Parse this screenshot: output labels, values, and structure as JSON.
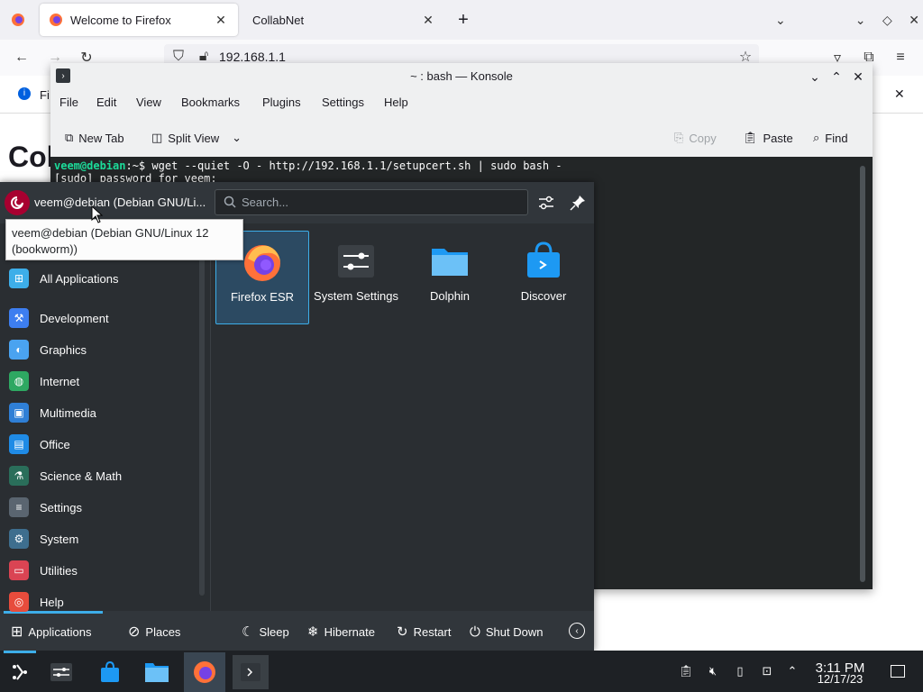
{
  "firefox": {
    "tabs": [
      {
        "title": "Welcome to Firefox",
        "active": true
      },
      {
        "title": "CollabNet",
        "active": false
      }
    ],
    "url": "192.168.1.1",
    "page_heading": "Col",
    "notification_visible_text": "Fi"
  },
  "konsole": {
    "title": "~ : bash — Konsole",
    "menu": [
      "File",
      "Edit",
      "View",
      "Bookmarks",
      "Plugins",
      "Settings",
      "Help"
    ],
    "toolbar": {
      "new_tab": "New Tab",
      "split_view": "Split View",
      "copy": "Copy",
      "paste": "Paste",
      "find": "Find"
    },
    "terminal": {
      "prompt": "veem@debian",
      "path_sep": ":~$",
      "command": " wget --quiet -O - http://192.168.1.1/setupcert.sh | sudo bash -",
      "line2": "[sudo] password for veem:"
    }
  },
  "kickoff": {
    "user": "veem@debian (Debian GNU/Li...",
    "search_placeholder": "Search...",
    "tooltip": "veem@debian (Debian GNU/Linux 12 (bookworm))",
    "categories": [
      {
        "label": "All Applications",
        "icon": "grid-icon",
        "color": "#3daee9"
      },
      {
        "label": "Development",
        "icon": "hammer-icon",
        "color": "#3d7ef0"
      },
      {
        "label": "Graphics",
        "icon": "graphics-icon",
        "color": "#4aa3f0"
      },
      {
        "label": "Internet",
        "icon": "globe-icon",
        "color": "#2ea862"
      },
      {
        "label": "Multimedia",
        "icon": "monitor-icon",
        "color": "#2f7fd6"
      },
      {
        "label": "Office",
        "icon": "office-icon",
        "color": "#1f8be6"
      },
      {
        "label": "Science & Math",
        "icon": "flask-icon",
        "color": "#2a6e5a"
      },
      {
        "label": "Settings",
        "icon": "settings-icon",
        "color": "#5a6570"
      },
      {
        "label": "System",
        "icon": "system-icon",
        "color": "#3e6e8e"
      },
      {
        "label": "Utilities",
        "icon": "toolbox-icon",
        "color": "#da4453"
      },
      {
        "label": "Help",
        "icon": "lifebuoy-icon",
        "color": "#e74c3c"
      }
    ],
    "favorites": [
      {
        "label": "Firefox ESR",
        "icon": "firefox-icon"
      },
      {
        "label": "System Settings",
        "icon": "system-settings-icon"
      },
      {
        "label": "Dolphin",
        "icon": "folder-icon"
      },
      {
        "label": "Discover",
        "icon": "discover-icon"
      }
    ],
    "footer": {
      "applications": "Applications",
      "places": "Places",
      "sleep": "Sleep",
      "hibernate": "Hibernate",
      "restart": "Restart",
      "shutdown": "Shut Down"
    }
  },
  "taskbar": {
    "time": "3:11 PM",
    "date": "12/17/23"
  },
  "colors": {
    "accent": "#3daee9",
    "panel_bg": "#2a2e32",
    "terminal_bg": "#232627",
    "prompt": "#1cdc9a"
  }
}
